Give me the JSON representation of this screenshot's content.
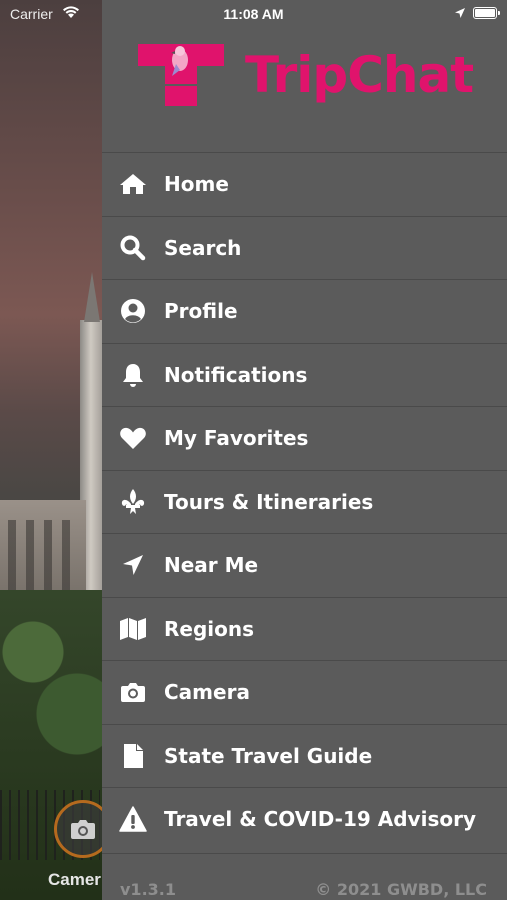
{
  "status_bar": {
    "carrier": "Carrier",
    "time": "11:08 AM",
    "battery_level": 1.0
  },
  "brand": {
    "name": "TripChat",
    "accent_color": "#e0136c"
  },
  "menu": {
    "items": [
      {
        "label": "Home",
        "icon": "home-icon"
      },
      {
        "label": "Search",
        "icon": "search-icon"
      },
      {
        "label": "Profile",
        "icon": "user-circle-icon"
      },
      {
        "label": "Notifications",
        "icon": "bell-icon"
      },
      {
        "label": "My Favorites",
        "icon": "heart-icon"
      },
      {
        "label": "Tours & Itineraries",
        "icon": "fleur-de-lis-icon"
      },
      {
        "label": "Near Me",
        "icon": "location-arrow-icon"
      },
      {
        "label": "Regions",
        "icon": "map-icon"
      },
      {
        "label": "Camera",
        "icon": "camera-icon"
      },
      {
        "label": "State Travel Guide",
        "icon": "document-icon"
      },
      {
        "label": "Travel & COVID-19 Advisory",
        "icon": "warning-icon"
      }
    ]
  },
  "footer": {
    "version": "v1.3.1",
    "copyright": "© 2021 GWBD, LLC"
  },
  "background": {
    "camera_button_label": "Camer"
  }
}
